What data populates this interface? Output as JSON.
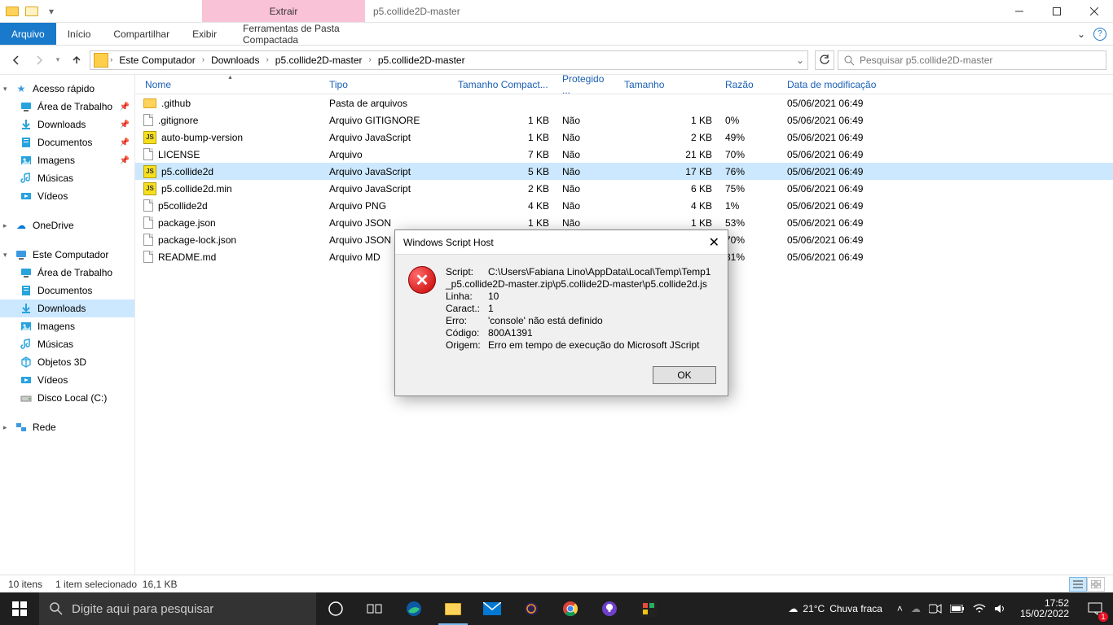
{
  "window": {
    "context_tab": "Extrair",
    "title": "p5.collide2D-master"
  },
  "ribbon": {
    "file": "Arquivo",
    "tabs": [
      "Início",
      "Compartilhar",
      "Exibir"
    ],
    "context": "Ferramentas de Pasta Compactada"
  },
  "breadcrumb": [
    "Este Computador",
    "Downloads",
    "p5.collide2D-master",
    "p5.collide2D-master"
  ],
  "search_placeholder": "Pesquisar p5.collide2D-master",
  "sidebar": {
    "quick": {
      "label": "Acesso rápido",
      "items": [
        {
          "label": "Área de Trabalho",
          "pinned": true,
          "icon": "desktop"
        },
        {
          "label": "Downloads",
          "pinned": true,
          "icon": "downloads"
        },
        {
          "label": "Documentos",
          "pinned": true,
          "icon": "documents"
        },
        {
          "label": "Imagens",
          "pinned": true,
          "icon": "pictures"
        },
        {
          "label": "Músicas",
          "pinned": false,
          "icon": "music"
        },
        {
          "label": "Vídeos",
          "pinned": false,
          "icon": "videos"
        }
      ]
    },
    "onedrive": "OneDrive",
    "thispc": {
      "label": "Este Computador",
      "items": [
        {
          "label": "Área de Trabalho",
          "icon": "desktop"
        },
        {
          "label": "Documentos",
          "icon": "documents"
        },
        {
          "label": "Downloads",
          "icon": "downloads",
          "selected": true
        },
        {
          "label": "Imagens",
          "icon": "pictures"
        },
        {
          "label": "Músicas",
          "icon": "music"
        },
        {
          "label": "Objetos 3D",
          "icon": "objects3d"
        },
        {
          "label": "Vídeos",
          "icon": "videos"
        },
        {
          "label": "Disco Local (C:)",
          "icon": "drive"
        }
      ]
    },
    "network": "Rede"
  },
  "columns": {
    "name": "Nome",
    "type": "Tipo",
    "csize": "Tamanho Compact...",
    "prot": "Protegido ...",
    "size": "Tamanho",
    "ratio": "Razão",
    "date": "Data de modificação"
  },
  "files": [
    {
      "name": ".github",
      "type": "Pasta de arquivos",
      "csize": "",
      "prot": "",
      "size": "",
      "ratio": "",
      "date": "05/06/2021 06:49",
      "icon": "folder"
    },
    {
      "name": ".gitignore",
      "type": "Arquivo GITIGNORE",
      "csize": "1 KB",
      "prot": "Não",
      "size": "1 KB",
      "ratio": "0%",
      "date": "05/06/2021 06:49",
      "icon": "file"
    },
    {
      "name": "auto-bump-version",
      "type": "Arquivo JavaScript",
      "csize": "1 KB",
      "prot": "Não",
      "size": "2 KB",
      "ratio": "49%",
      "date": "05/06/2021 06:49",
      "icon": "js"
    },
    {
      "name": "LICENSE",
      "type": "Arquivo",
      "csize": "7 KB",
      "prot": "Não",
      "size": "21 KB",
      "ratio": "70%",
      "date": "05/06/2021 06:49",
      "icon": "file"
    },
    {
      "name": "p5.collide2d",
      "type": "Arquivo JavaScript",
      "csize": "5 KB",
      "prot": "Não",
      "size": "17 KB",
      "ratio": "76%",
      "date": "05/06/2021 06:49",
      "icon": "js",
      "selected": true
    },
    {
      "name": "p5.collide2d.min",
      "type": "Arquivo JavaScript",
      "csize": "2 KB",
      "prot": "Não",
      "size": "6 KB",
      "ratio": "75%",
      "date": "05/06/2021 06:49",
      "icon": "js"
    },
    {
      "name": "p5collide2d",
      "type": "Arquivo PNG",
      "csize": "4 KB",
      "prot": "Não",
      "size": "4 KB",
      "ratio": "1%",
      "date": "05/06/2021 06:49",
      "icon": "file"
    },
    {
      "name": "package.json",
      "type": "Arquivo JSON",
      "csize": "1 KB",
      "prot": "Não",
      "size": "1 KB",
      "ratio": "53%",
      "date": "05/06/2021 06:49",
      "icon": "file"
    },
    {
      "name": "package-lock.json",
      "type": "Arquivo JSON",
      "csize": "",
      "prot": "",
      "size": "",
      "ratio": "70%",
      "date": "05/06/2021 06:49",
      "icon": "file"
    },
    {
      "name": "README.md",
      "type": "Arquivo MD",
      "csize": "",
      "prot": "",
      "size": "",
      "ratio": "81%",
      "date": "05/06/2021 06:49",
      "icon": "file"
    }
  ],
  "status": {
    "count": "10 itens",
    "sel": "1 item selecionado",
    "size": "16,1 KB"
  },
  "dialog": {
    "title": "Windows Script Host",
    "labels": {
      "script": "Script:",
      "line": "Linha:",
      "char": "Caract.:",
      "error": "Erro:",
      "code": "Código:",
      "origin": "Origem:"
    },
    "script_path": "C:\\Users\\Fabiana Lino\\AppData\\Local\\Temp\\Temp1_p5.collide2D-master.zip\\p5.collide2D-master\\p5.collide2d.js",
    "line": "10",
    "char": "1",
    "error": "'console' não está definido",
    "code": "800A1391",
    "origin": "Erro em tempo de execução do Microsoft JScript",
    "ok": "OK"
  },
  "taskbar": {
    "search_placeholder": "Digite aqui para pesquisar",
    "weather_temp": "21°C",
    "weather_text": "Chuva fraca",
    "time": "17:52",
    "date": "15/02/2022"
  }
}
